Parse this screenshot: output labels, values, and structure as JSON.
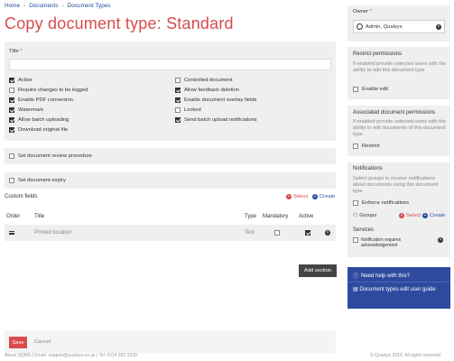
{
  "breadcrumb": [
    "Home",
    "Documents",
    "Document Types"
  ],
  "page_title": "Copy document type: Standard",
  "title_field": {
    "label": "Title",
    "required": "*",
    "value": ""
  },
  "options_left": [
    {
      "label": "Active",
      "checked": true
    },
    {
      "label": "Require changes to be logged",
      "checked": false
    },
    {
      "label": "Enable PDF conversion",
      "checked": true
    },
    {
      "label": "Watermark",
      "checked": true
    },
    {
      "label": "Allow batch uploading",
      "checked": true
    },
    {
      "label": "Download original file",
      "checked": true
    }
  ],
  "options_right": [
    {
      "label": "Controlled document",
      "checked": false
    },
    {
      "label": "Allow feedback deletion",
      "checked": true
    },
    {
      "label": "Enable document overlay fields",
      "checked": true
    },
    {
      "label": "Locked",
      "checked": false
    },
    {
      "label": "Send batch upload notifications",
      "checked": true
    }
  ],
  "review_procedure": {
    "label": "Set document review procedure",
    "checked": false
  },
  "expiry": {
    "label": "Set document expiry",
    "checked": false
  },
  "custom_fields": {
    "title": "Custom fields",
    "select": "Select",
    "create": "Create",
    "headers": {
      "order": "Order",
      "title": "Title",
      "type": "Type",
      "mandatory": "Mandatory",
      "active": "Active"
    },
    "rows": [
      {
        "title": "Printed location",
        "type": "Text",
        "mandatory": false,
        "active": true
      }
    ]
  },
  "add_section": "Add section",
  "save": "Save",
  "cancel": "Cancel",
  "footer_left": "About SQMS  |  Email: support@qualsys.co.uk  |  Tel: 0114 282 3339",
  "footer_right": "© Qualsys 2019. All rights reserved",
  "owner": {
    "label": "Owner",
    "required": "*",
    "value": "Admin, Qualsys"
  },
  "restrict": {
    "title": "Restrict permissions",
    "text": "If enabled provide selected users with the ability to edit this document type",
    "option": "Enable edit"
  },
  "associated": {
    "title": "Associated document permissions",
    "text": "If enabled provide selected users with the ability to edit documents of this document type",
    "option": "Restrict"
  },
  "notifications": {
    "title": "Notifications",
    "text": "Select groups to receive notifications about documents using this document type",
    "option": "Enforce notifications",
    "groups": "Groups",
    "select": "Select",
    "create": "Create"
  },
  "services": {
    "title": "Services",
    "item": "Notification requires acknowledgement"
  },
  "help": {
    "title": "Need help with this?",
    "link": "Document types edit user guide"
  },
  "colors": {
    "accent": "#d84c4c",
    "brand": "#1f4e9c",
    "help_bg": "#2e4a9e"
  }
}
